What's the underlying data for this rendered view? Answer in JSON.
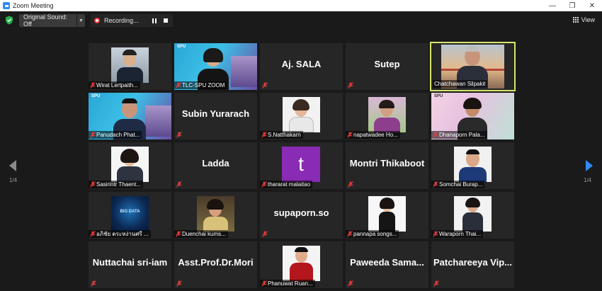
{
  "window": {
    "title": "Zoom Meeting",
    "controls": [
      "—",
      "❐",
      "✕"
    ]
  },
  "toolbar": {
    "original_sound_label": "Original Sound: Off",
    "recording_label": "Recording...",
    "view_label": "View"
  },
  "pagination": {
    "left": "1/4",
    "right": "1/4"
  },
  "colors": {
    "active_speaker": "#d8e56a",
    "muted_mic": "#e33c3c",
    "accent": "#2d8cff"
  },
  "participants": [
    {
      "name": "Wirat Lertpaith...",
      "video": true,
      "muted": true
    },
    {
      "name": "TLC-SPU ZOOM",
      "video": true,
      "muted": true
    },
    {
      "name": "Aj. SALA",
      "video": false,
      "muted": true
    },
    {
      "name": "Sutep",
      "video": false,
      "muted": true
    },
    {
      "name": "Chatchawan Silpakit",
      "video": true,
      "muted": false,
      "active": true
    },
    {
      "name": "Panudach Phat...",
      "video": true,
      "muted": true
    },
    {
      "name": "Subin Yurarach",
      "video": false,
      "muted": true
    },
    {
      "name": "S.Natthakarn",
      "video": true,
      "muted": true
    },
    {
      "name": "napatwadee Ho...",
      "video": true,
      "muted": true
    },
    {
      "name": "Dhanaporn Pala...",
      "video": true,
      "muted": true
    },
    {
      "name": "Sasirintr Thaent...",
      "video": true,
      "muted": true
    },
    {
      "name": "Ladda",
      "video": false,
      "muted": true
    },
    {
      "name": "thararat malaitao",
      "video": true,
      "muted": true,
      "letter": "t"
    },
    {
      "name": "Montri Thikaboot",
      "video": false,
      "muted": true
    },
    {
      "name": "Somchai Burap...",
      "video": true,
      "muted": true
    },
    {
      "name": "อภิชัย ตระหง่านศรี ...",
      "video": true,
      "muted": true
    },
    {
      "name": "Duenchai kums...",
      "video": true,
      "muted": true
    },
    {
      "name": "supaporn.so",
      "video": false,
      "muted": true
    },
    {
      "name": "pannapa songs...",
      "video": true,
      "muted": true
    },
    {
      "name": "Waraporn Thai...",
      "video": true,
      "muted": true
    },
    {
      "name": "Nuttachai sri-iam",
      "video": false,
      "muted": true
    },
    {
      "name": "Asst.Prof.Dr.Mori",
      "video": false,
      "muted": true
    },
    {
      "name": "Phanuwat Ruan...",
      "video": true,
      "muted": true
    },
    {
      "name": "Paweeda  Sama...",
      "video": false,
      "muted": true
    },
    {
      "name": "Patchareeya  Vip...",
      "video": false,
      "muted": true
    }
  ],
  "tile_text": {
    "spu_logo_1": "SPU",
    "spu_logo_2": "SPU",
    "spu_logo_3": "SPU",
    "big_data": "BIG DATA"
  }
}
